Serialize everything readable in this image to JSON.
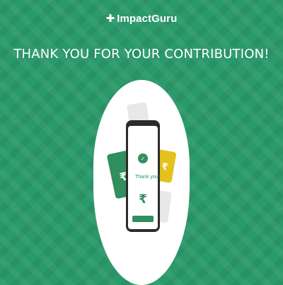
{
  "brand": {
    "logo_mark": "✚",
    "name": "ImpactGuru"
  },
  "headline": "THANK YOU FOR YOUR CONTRIBUTION!",
  "illustration": {
    "phone_message": "Thank you!",
    "phone_subtext_left": "",
    "phone_subtext_right": "",
    "phone_button_label": "",
    "currency_symbol": "₹",
    "check_mark": "✓"
  },
  "colors": {
    "background": "#2a9a6a",
    "accent_green": "#2f8f5e",
    "card_yellow": "#e2c21b",
    "white": "#ffffff"
  }
}
